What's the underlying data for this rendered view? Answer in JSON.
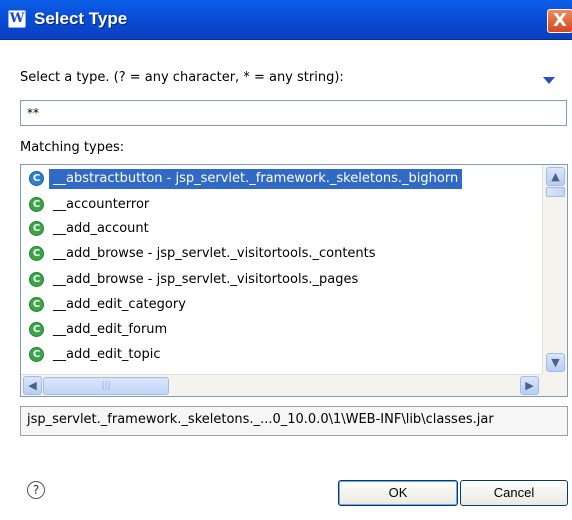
{
  "window": {
    "app_icon": "W",
    "title": "Select Type",
    "close_glyph": "X"
  },
  "prompt": {
    "label": "Select a type. (? = any character, * = any string):",
    "pattern_value": "**"
  },
  "list": {
    "label": "Matching types:",
    "items": [
      {
        "icon": "C",
        "text": "__abstractbutton - jsp_servlet._framework._skeletons._bighorn",
        "selected": true
      },
      {
        "icon": "C",
        "text": "__accounterror",
        "selected": false
      },
      {
        "icon": "C",
        "text": "__add_account",
        "selected": false
      },
      {
        "icon": "C",
        "text": "__add_browse - jsp_servlet._visitortools._contents",
        "selected": false
      },
      {
        "icon": "C",
        "text": "__add_browse - jsp_servlet._visitortools._pages",
        "selected": false
      },
      {
        "icon": "C",
        "text": "__add_edit_category",
        "selected": false
      },
      {
        "icon": "C",
        "text": "__add_edit_forum",
        "selected": false
      },
      {
        "icon": "C",
        "text": "__add_edit_topic",
        "selected": false
      }
    ],
    "scroll_up": "▲",
    "scroll_down": "▼",
    "scroll_left": "◀",
    "scroll_right": "▶",
    "hthumb_grip": "|||"
  },
  "status": {
    "text": "jsp_servlet._framework._skeletons._...0_10.0.0\\1\\WEB-INF\\lib\\classes.jar"
  },
  "footer": {
    "help_glyph": "?",
    "ok_label": "OK",
    "cancel_label": "Cancel"
  },
  "colors": {
    "titlebar": "#0a4fd8",
    "selection": "#316ac5",
    "class_icon": "#37a845"
  }
}
